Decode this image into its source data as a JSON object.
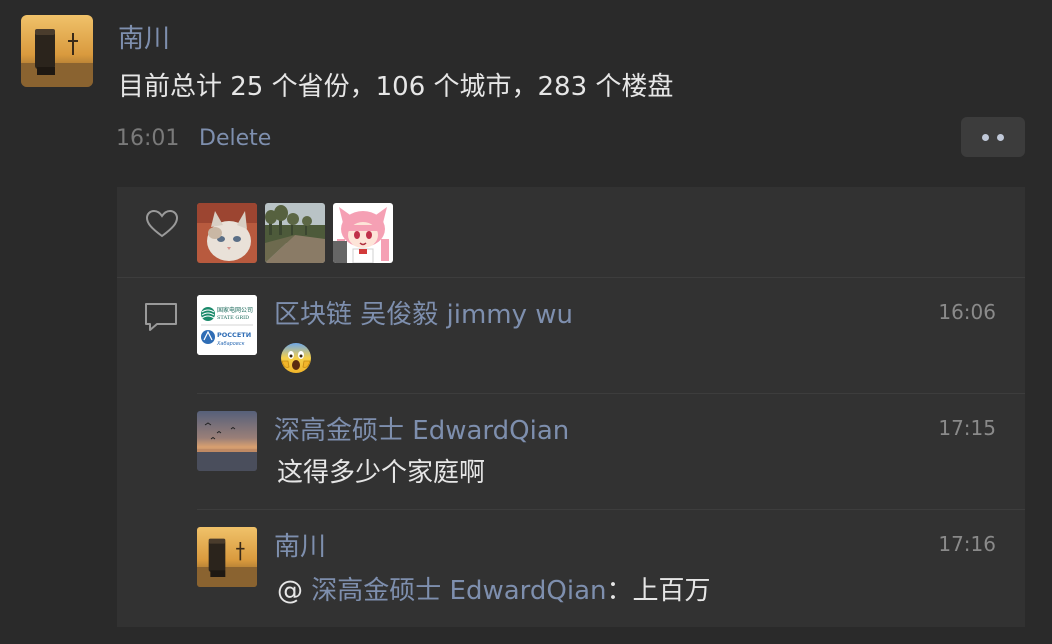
{
  "post": {
    "author": "南川",
    "text": "目前总计 25 个省份，106 个城市，283 个楼盘",
    "time": "16:01",
    "delete_label": "Delete"
  },
  "likes": {
    "users": [
      {
        "avatar": "cat-photo"
      },
      {
        "avatar": "road-landscape-photo"
      },
      {
        "avatar": "anime-girl-pink-hair"
      }
    ]
  },
  "comments": [
    {
      "author": "区块链 吴俊毅 jimmy wu",
      "time": "16:06",
      "text": "😱",
      "avatar_logo_lines": [
        "国家电网公司",
        "STATE GRID",
        "РОССЕТИ",
        "Хабаровск"
      ]
    },
    {
      "author": "深高金硕士 EdwardQian",
      "time": "17:15",
      "text": "这得多少个家庭啊"
    },
    {
      "author": "南川",
      "time": "17:16",
      "reply_prefix": "@",
      "reply_to": "深高金硕士 EdwardQian",
      "text": "：上百万"
    }
  ],
  "colors": {
    "background": "#2a2a2a",
    "panel": "#323232",
    "name_link": "#7e8fae",
    "text": "#e6e6e6",
    "meta": "#7a7a7a"
  }
}
